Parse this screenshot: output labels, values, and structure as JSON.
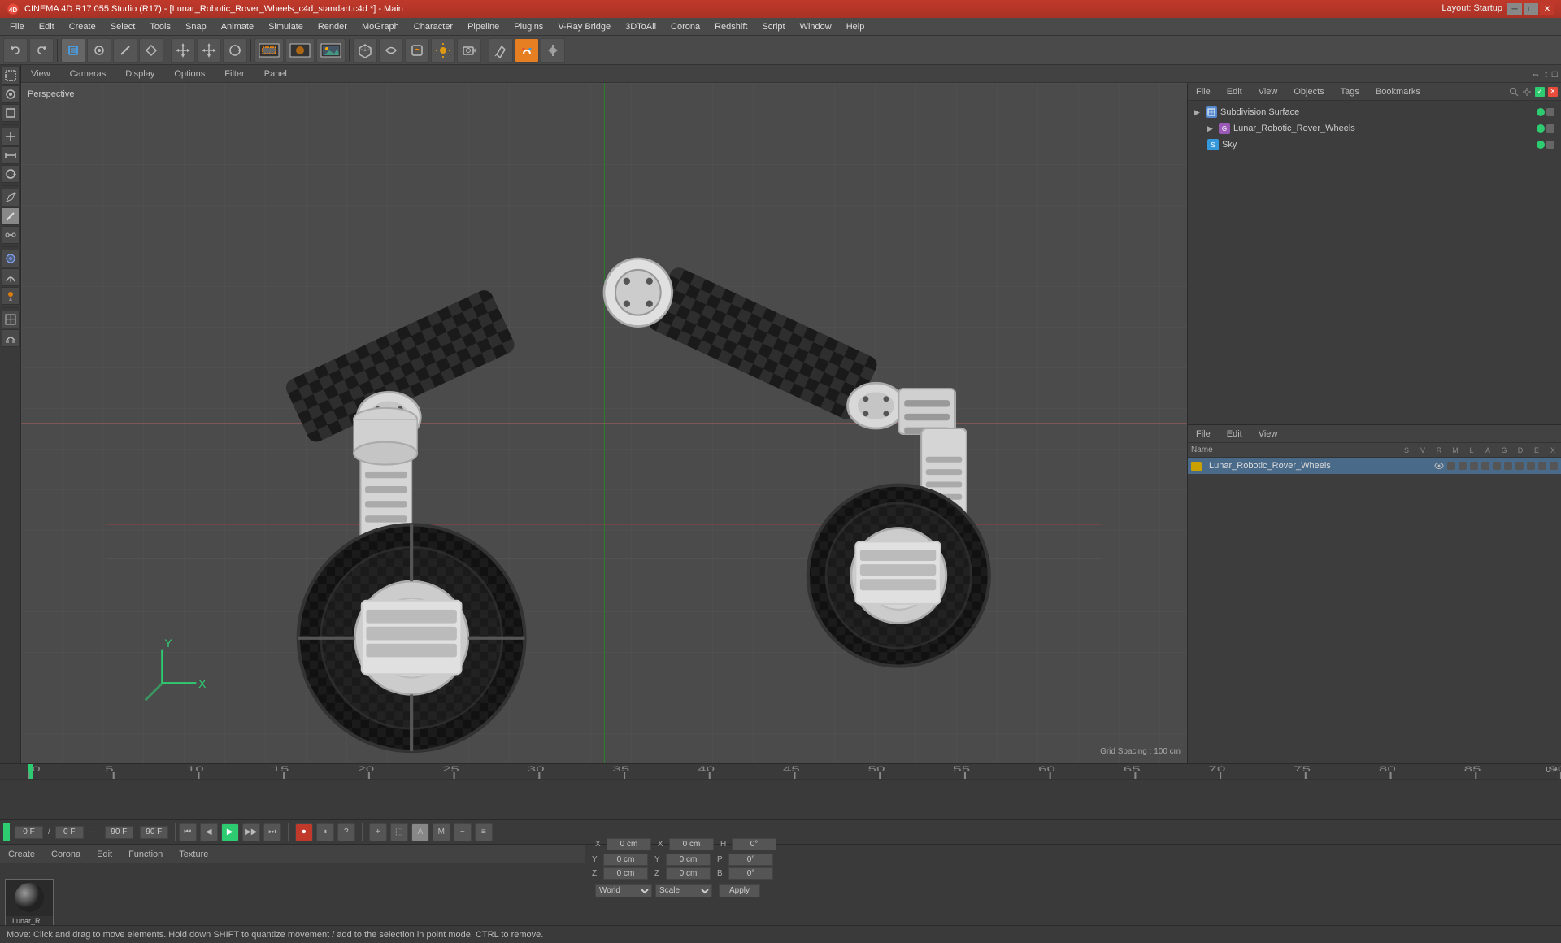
{
  "titlebar": {
    "title": "CINEMA 4D R17.055 Studio (R17) - [Lunar_Robotic_Rover_Wheels_c4d_standart.c4d *] - Main",
    "layout_label": "Layout:",
    "layout_value": "Startup"
  },
  "menubar": {
    "items": [
      "File",
      "Edit",
      "Create",
      "Select",
      "Tools",
      "Snap",
      "Animate",
      "Simulate",
      "Render",
      "MoGraph",
      "Character",
      "Pipeline",
      "Plugins",
      "V-Ray Bridge",
      "3DToAll",
      "Corona",
      "Redshift",
      "Script",
      "Window",
      "Help"
    ]
  },
  "toolbar": {
    "undo_label": "↩",
    "redo_label": "↪"
  },
  "viewport": {
    "label": "Perspective",
    "header_tabs": [
      "View",
      "Cameras",
      "Display",
      "Options",
      "Filter",
      "Panel"
    ],
    "grid_spacing": "Grid Spacing : 100 cm",
    "header_controls": [
      "⇔",
      "↕",
      "□"
    ]
  },
  "object_manager_top": {
    "tabs": [
      "File",
      "Edit",
      "View",
      "Objects",
      "Tags",
      "Bookmarks"
    ],
    "items": [
      {
        "name": "Subdivision Surface",
        "indent": 0,
        "icon": "subdiv"
      },
      {
        "name": "Lunar_Robotic_Rover_Wheels",
        "indent": 1,
        "icon": "group"
      },
      {
        "name": "Sky",
        "indent": 1,
        "icon": "sky"
      }
    ]
  },
  "object_manager_bottom": {
    "tabs": [
      "File",
      "Edit",
      "View"
    ],
    "columns": [
      "Name",
      "S",
      "V",
      "R",
      "M",
      "L",
      "A",
      "G",
      "D",
      "E",
      "X"
    ],
    "items": [
      {
        "name": "Lunar_Robotic_Rover_Wheels",
        "icon": "folder"
      }
    ]
  },
  "timeline": {
    "ruler_start": 0,
    "ruler_end": 90,
    "ruler_step": 5,
    "current_frame": "0 F",
    "fps": "0 F",
    "end_frame": "90 F",
    "fps_value": "90 F",
    "frame_input": "0 F"
  },
  "material_area": {
    "tabs": [
      "Create",
      "Corona",
      "Edit",
      "Function",
      "Texture"
    ],
    "material_name": "Lunar_R..."
  },
  "coords": {
    "x_pos": "0 cm",
    "y_pos": "0 cm",
    "z_pos": "0 cm",
    "x_rot": "0 cm",
    "y_rot": "0 cm",
    "z_rot": "0 cm",
    "x_scale": "H",
    "y_scale": "P",
    "z_scale": "B",
    "h_val": "0°",
    "p_val": "0°",
    "b_val": "0°",
    "mode": "World",
    "scale_mode": "Scale",
    "apply_label": "Apply"
  },
  "statusbar": {
    "text": "Move: Click and drag to move elements. Hold down SHIFT to quantize movement / add to the selection in point mode. CTRL to remove."
  },
  "icons": {
    "move": "✥",
    "rotate": "↻",
    "scale": "⇔",
    "select": "⬚",
    "live_sel": "⊕",
    "rect_sel": "▭",
    "loop_sel": "⌀",
    "subdivide": "⊞",
    "play": "▶",
    "pause": "⏸",
    "stop": "■",
    "rewind": "⏮",
    "forward": "⏭",
    "step_back": "◀",
    "step_fwd": "▶"
  }
}
